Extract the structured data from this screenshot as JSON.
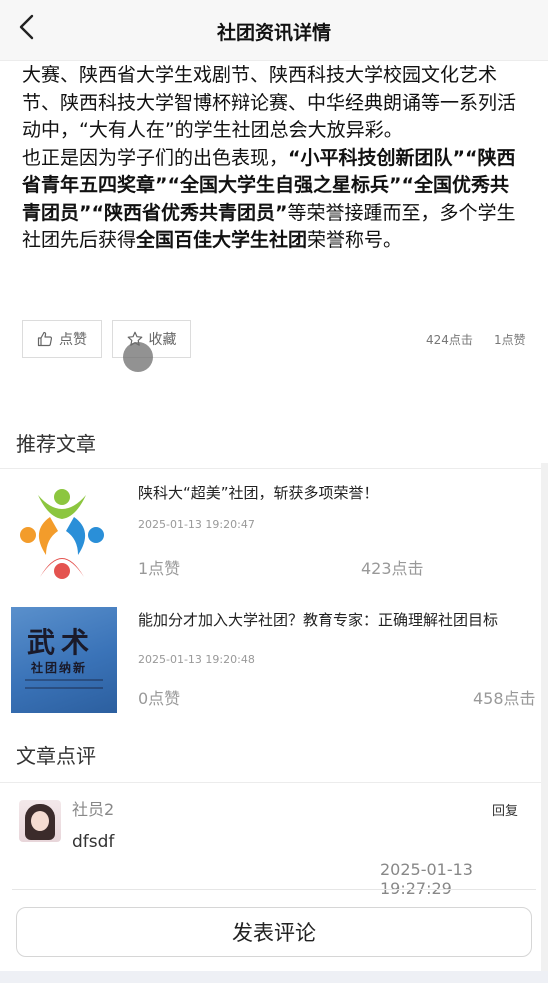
{
  "header": {
    "title": "社团资讯详情",
    "back_icon": "chevron-left-icon"
  },
  "article": {
    "para1": "大赛、陕西省大学生戏剧节、陕西科技大学校园文化艺术节、陕西科技大学智博杯辩论赛、中华经典朗诵等一系列活动中，“大有人在”的学生社团总会大放异彩。",
    "para2_prefix": "也正是因为学子们的出色表现，",
    "honor1": "“小平科技创新团队”",
    "honor2": "“陕西省青年五四奖章”",
    "honor3": "“全国大学生自强之星标兵”",
    "honor4": "“全国优秀共青团员”",
    "honor5": "“陕西省优秀共青团员”",
    "para2_middle": "等荣誉接踵而至，多个学生社团先后获得",
    "honor6": "全国百佳大学生社团",
    "para2_suffix": "荣誉称号。"
  },
  "actions": {
    "like_label": "点赞",
    "like_icon": "thumbs-up-icon",
    "fav_label": "收藏",
    "fav_icon": "star-icon",
    "clicks": "424点击",
    "likes": "1点赞"
  },
  "recommend": {
    "title": "推荐文章",
    "items": [
      {
        "title": "陕科大“超美”社团，斩获多项荣誉！",
        "date": "2025-01-13 19:20:47",
        "likes": "1点赞",
        "clicks": "423点击"
      },
      {
        "title": "能加分才加入大学社团？教育专家：正确理解社团目标",
        "date": "2025-01-13 19:20:48",
        "likes": "0点赞",
        "clicks": "458点击",
        "thumb_text_big": "武术",
        "thumb_text_small": "社团纳新"
      }
    ]
  },
  "comments": {
    "title": "文章点评",
    "items": [
      {
        "user": "社员2",
        "reply_label": "回复",
        "text": "dfsdf",
        "time": "2025-01-13 19:27:29"
      }
    ],
    "post_label": "发表评论"
  },
  "colors": {
    "logo_green": "#8cc63f",
    "logo_blue": "#2a8fd8",
    "logo_orange": "#f39c2b",
    "logo_red": "#e4534f"
  }
}
